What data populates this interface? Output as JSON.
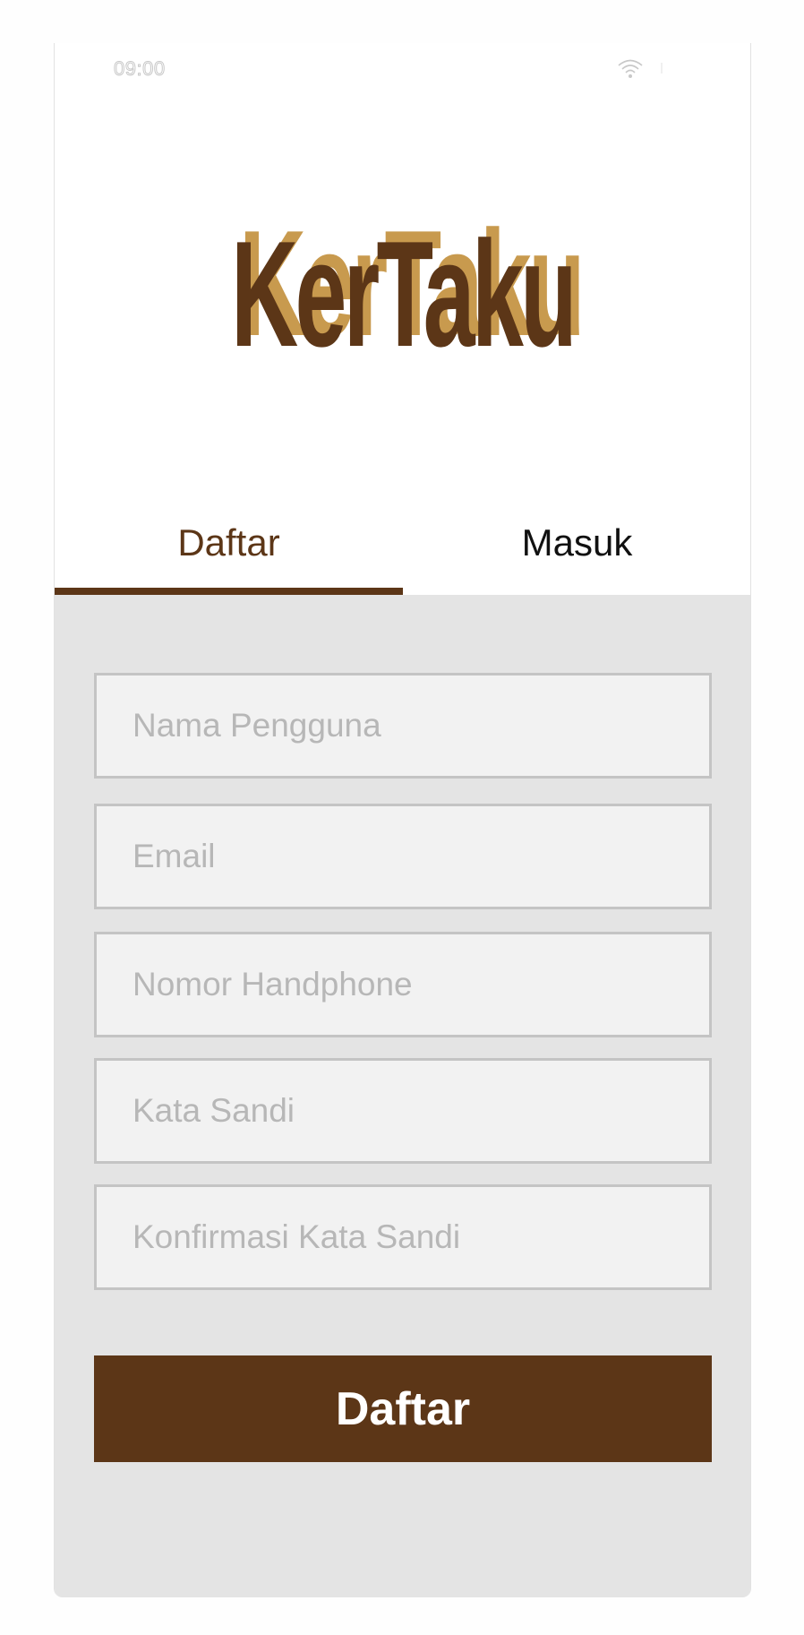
{
  "status_bar": {
    "time": "09:00",
    "wifi_icon": "wifi-icon",
    "battery_icon": "battery-icon"
  },
  "app": {
    "logo_text": "KerTaku",
    "brand_color": "#5c3617",
    "accent_color": "#c89a4e"
  },
  "tabs": [
    {
      "label": "Daftar",
      "active": true
    },
    {
      "label": "Masuk",
      "active": false
    }
  ],
  "form": {
    "fields": [
      {
        "placeholder": "Nama Pengguna",
        "value": ""
      },
      {
        "placeholder": "Email",
        "value": ""
      },
      {
        "placeholder": "Nomor Handphone",
        "value": ""
      },
      {
        "placeholder": "Kata Sandi",
        "value": ""
      },
      {
        "placeholder": "Konfirmasi Kata Sandi",
        "value": ""
      }
    ],
    "submit_label": "Daftar"
  }
}
